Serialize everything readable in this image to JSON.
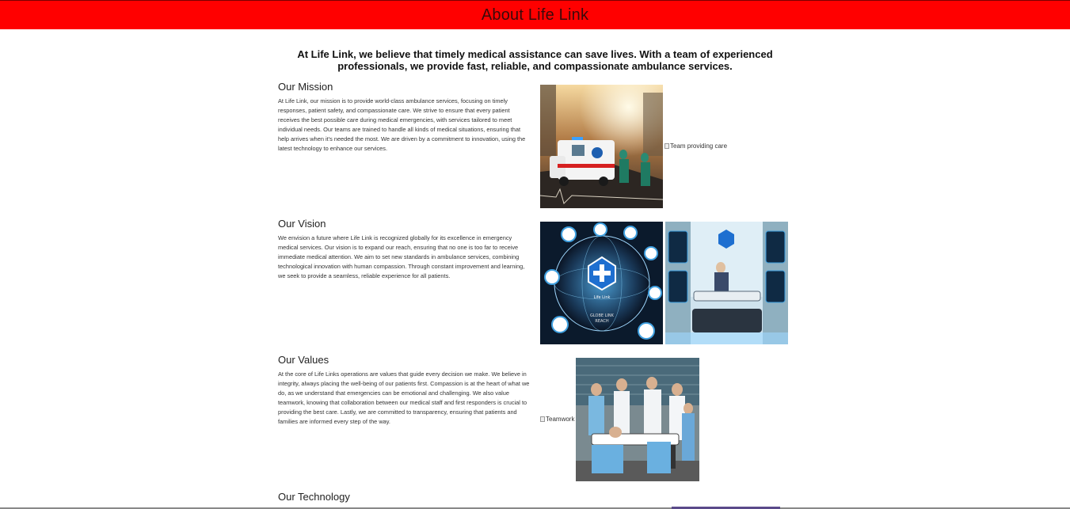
{
  "header": {
    "title": "About Life Link",
    "background": "#ff0000"
  },
  "intro": "At Life Link, we believe that timely medical assistance can save lives. With a team of experienced professionals, we provide fast, reliable, and compassionate ambulance services.",
  "sections": [
    {
      "title": "Our Mission",
      "text": "At Life Link, our mission is to provide world-class ambulance services, focusing on timely responses, patient safety, and compassionate care. We strive to ensure that every patient receives the best possible care during medical emergencies, with services tailored to meet individual needs. Our teams are trained to handle all kinds of medical situations, ensuring that help arrives when it's needed the most. We are driven by a commitment to innovation, using the latest technology to enhance our services.",
      "broken_image_alt": "Team providing care"
    },
    {
      "title": "Our Vision",
      "text": "We envision a future where Life Link is recognized globally for its excellence in emergency medical services. Our vision is to expand our reach, ensuring that no one is too far to receive immediate medical attention. We aim to set new standards in ambulance services, combining technological innovation with human compassion. Through constant improvement and learning, we seek to provide a seamless, reliable experience for all patients.",
      "image_texts": [
        "Life Link",
        "GLOBE LINK",
        "REACH"
      ]
    },
    {
      "title": "Our Values",
      "text": "At the core of Life Links operations are values that guide every decision we make. We believe in integrity, always placing the well-being of our patients first. Compassion is at the heart of what we do, as we understand that emergencies can be emotional and challenging. We also value teamwork, knowing that collaboration between our medical staff and first responders is crucial to providing the best care. Lastly, we are committed to transparency, ensuring that patients and families are informed every step of the way.",
      "broken_image_alt": "Teamwork"
    },
    {
      "title": "Our Technology"
    }
  ]
}
